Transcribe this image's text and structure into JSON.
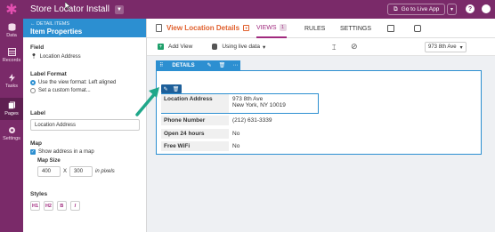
{
  "app": {
    "title": "Store Locator Install",
    "live_button": "Go to Live App"
  },
  "nav": {
    "items": [
      "Data",
      "Records",
      "Tasks",
      "Pages",
      "Settings"
    ]
  },
  "props": {
    "breadcrumb": "DETAIL ITEMS",
    "title": "Item Properties",
    "field_label": "Field",
    "field_value": "Location Address",
    "label_format_label": "Label Format",
    "label_format_opt1": "Use the view format: Left aligned",
    "label_format_opt2": "Set a custom format...",
    "label_label": "Label",
    "label_value": "Location Address",
    "map_label": "Map",
    "map_checkbox": "Show address in a map",
    "map_size_label": "Map Size",
    "map_width": "400",
    "map_x": "X",
    "map_height": "300",
    "map_unit": "in pixels",
    "styles_label": "Styles",
    "styles": [
      "H1",
      "H2",
      "B",
      "I"
    ]
  },
  "view": {
    "title": "View Location Details",
    "tabs": {
      "views": "VIEWS",
      "views_count": "1",
      "rules": "RULES",
      "settings": "SETTINGS"
    }
  },
  "toolbar": {
    "add_view": "Add View",
    "data_source": "Using live data",
    "record": "973 8th Ave"
  },
  "details": {
    "bar_label": "DETAILS",
    "rows": [
      {
        "label": "Location Address",
        "value_line1": "973 8th Ave",
        "value_line2": "New York, NY 10019"
      },
      {
        "label": "Phone Number",
        "value": "(212) 631-3339"
      },
      {
        "label": "Open 24 hours",
        "value": "No"
      },
      {
        "label": "Free WiFi",
        "value": "No"
      }
    ]
  },
  "colors": {
    "brand": "#7a2a69",
    "accent": "#2c8fd1",
    "view_title": "#e0602d",
    "arrow": "#1fa78a"
  }
}
